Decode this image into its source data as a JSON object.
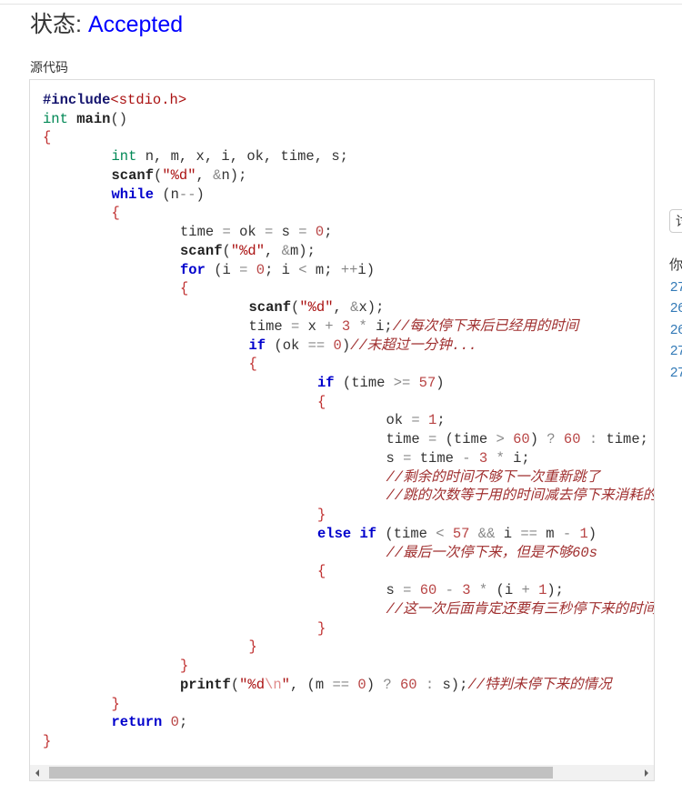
{
  "status": {
    "label": "状态:",
    "value": "Accepted"
  },
  "source_label": "源代码",
  "code": {
    "lines": [
      {
        "indent": 0,
        "tokens": [
          {
            "pp": "#include"
          },
          {
            "hdr": "<stdio.h>"
          }
        ]
      },
      {
        "indent": 0,
        "tokens": [
          {
            "type": "int"
          },
          {
            "x": " "
          },
          {
            "fn": "main"
          },
          {
            "x": "()"
          }
        ]
      },
      {
        "indent": 0,
        "tokens": [
          {
            "br": "{"
          }
        ]
      },
      {
        "indent": 1,
        "tokens": [
          {
            "type": "int"
          },
          {
            "x": " n, m, x, i, ok, time, s;"
          }
        ]
      },
      {
        "indent": 1,
        "tokens": [
          {
            "fn": "scanf"
          },
          {
            "x": "("
          },
          {
            "str": "\"%d\""
          },
          {
            "x": ", "
          },
          {
            "op": "&"
          },
          {
            "x": "n);"
          }
        ]
      },
      {
        "indent": 1,
        "tokens": [
          {
            "kw": "while"
          },
          {
            "x": " (n"
          },
          {
            "op": "--"
          },
          {
            "x": ")"
          }
        ]
      },
      {
        "indent": 1,
        "tokens": [
          {
            "br": "{"
          }
        ]
      },
      {
        "indent": 2,
        "tokens": [
          {
            "x": "time "
          },
          {
            "op": "="
          },
          {
            "x": " ok "
          },
          {
            "op": "="
          },
          {
            "x": " s "
          },
          {
            "op": "="
          },
          {
            "x": " "
          },
          {
            "num": "0"
          },
          {
            "x": ";"
          }
        ]
      },
      {
        "indent": 2,
        "tokens": [
          {
            "fn": "scanf"
          },
          {
            "x": "("
          },
          {
            "str": "\"%d\""
          },
          {
            "x": ", "
          },
          {
            "op": "&"
          },
          {
            "x": "m);"
          }
        ]
      },
      {
        "indent": 2,
        "tokens": [
          {
            "kw": "for"
          },
          {
            "x": " (i "
          },
          {
            "op": "="
          },
          {
            "x": " "
          },
          {
            "num": "0"
          },
          {
            "x": "; i "
          },
          {
            "op": "<"
          },
          {
            "x": " m; "
          },
          {
            "op": "++"
          },
          {
            "x": "i)"
          }
        ]
      },
      {
        "indent": 2,
        "tokens": [
          {
            "br": "{"
          }
        ]
      },
      {
        "indent": 3,
        "tokens": [
          {
            "fn": "scanf"
          },
          {
            "x": "("
          },
          {
            "str": "\"%d\""
          },
          {
            "x": ", "
          },
          {
            "op": "&"
          },
          {
            "x": "x);"
          }
        ]
      },
      {
        "indent": 3,
        "tokens": [
          {
            "x": "time "
          },
          {
            "op": "="
          },
          {
            "x": " x "
          },
          {
            "op": "+"
          },
          {
            "x": " "
          },
          {
            "num": "3"
          },
          {
            "x": " "
          },
          {
            "op": "*"
          },
          {
            "x": " i;"
          },
          {
            "cm": "//每次停下来后已经用的时间"
          }
        ]
      },
      {
        "indent": 3,
        "tokens": [
          {
            "kw": "if"
          },
          {
            "x": " (ok "
          },
          {
            "op": "=="
          },
          {
            "x": " "
          },
          {
            "num": "0"
          },
          {
            "x": ")"
          },
          {
            "cm": "//未超过一分钟..."
          }
        ]
      },
      {
        "indent": 3,
        "tokens": [
          {
            "br": "{"
          }
        ]
      },
      {
        "indent": 4,
        "tokens": [
          {
            "kw": "if"
          },
          {
            "x": " (time "
          },
          {
            "op": ">="
          },
          {
            "x": " "
          },
          {
            "num": "57"
          },
          {
            "x": ")"
          }
        ]
      },
      {
        "indent": 4,
        "tokens": [
          {
            "br": "{"
          }
        ]
      },
      {
        "indent": 5,
        "tokens": [
          {
            "x": "ok "
          },
          {
            "op": "="
          },
          {
            "x": " "
          },
          {
            "num": "1"
          },
          {
            "x": ";"
          }
        ]
      },
      {
        "indent": 5,
        "tokens": [
          {
            "x": "time "
          },
          {
            "op": "="
          },
          {
            "x": " (time "
          },
          {
            "op": ">"
          },
          {
            "x": " "
          },
          {
            "num": "60"
          },
          {
            "x": ") "
          },
          {
            "op": "?"
          },
          {
            "x": " "
          },
          {
            "num": "60"
          },
          {
            "x": " "
          },
          {
            "op": ":"
          },
          {
            "x": " time;"
          }
        ]
      },
      {
        "indent": 5,
        "tokens": [
          {
            "x": "s "
          },
          {
            "op": "="
          },
          {
            "x": " time "
          },
          {
            "op": "-"
          },
          {
            "x": " "
          },
          {
            "num": "3"
          },
          {
            "x": " "
          },
          {
            "op": "*"
          },
          {
            "x": " i;"
          }
        ]
      },
      {
        "indent": 5,
        "tokens": [
          {
            "cm": "//剩余的时间不够下一次重新跳了"
          }
        ]
      },
      {
        "indent": 5,
        "tokens": [
          {
            "cm": "//跳的次数等于用的时间减去停下来消耗的"
          }
        ]
      },
      {
        "indent": 4,
        "tokens": [
          {
            "br": "}"
          }
        ]
      },
      {
        "indent": 4,
        "tokens": [
          {
            "kw": "else if"
          },
          {
            "x": " (time "
          },
          {
            "op": "<"
          },
          {
            "x": " "
          },
          {
            "num": "57"
          },
          {
            "x": " "
          },
          {
            "op": "&&"
          },
          {
            "x": " i "
          },
          {
            "op": "=="
          },
          {
            "x": " m "
          },
          {
            "op": "-"
          },
          {
            "x": " "
          },
          {
            "num": "1"
          },
          {
            "x": ")"
          }
        ]
      },
      {
        "indent": 5,
        "tokens": [
          {
            "cm": "//最后一次停下来，但是不够60s"
          }
        ]
      },
      {
        "indent": 4,
        "tokens": [
          {
            "br": "{"
          }
        ]
      },
      {
        "indent": 5,
        "tokens": [
          {
            "x": "s "
          },
          {
            "op": "="
          },
          {
            "x": " "
          },
          {
            "num": "60"
          },
          {
            "x": " "
          },
          {
            "op": "-"
          },
          {
            "x": " "
          },
          {
            "num": "3"
          },
          {
            "x": " "
          },
          {
            "op": "*"
          },
          {
            "x": " (i "
          },
          {
            "op": "+"
          },
          {
            "x": " "
          },
          {
            "num": "1"
          },
          {
            "x": ");"
          }
        ]
      },
      {
        "indent": 5,
        "tokens": [
          {
            "cm": "//这一次后面肯定还要有三秒停下来的时间"
          }
        ]
      },
      {
        "indent": 4,
        "tokens": [
          {
            "br": "}"
          }
        ]
      },
      {
        "indent": 3,
        "tokens": [
          {
            "br": "}"
          }
        ]
      },
      {
        "indent": 2,
        "tokens": [
          {
            "br": "}"
          }
        ]
      },
      {
        "indent": 2,
        "tokens": [
          {
            "fn": "printf"
          },
          {
            "x": "("
          },
          {
            "str": "\"%d"
          },
          {
            "esc": "\\n"
          },
          {
            "str": "\""
          },
          {
            "x": ", (m "
          },
          {
            "op": "=="
          },
          {
            "x": " "
          },
          {
            "num": "0"
          },
          {
            "x": ") "
          },
          {
            "op": "?"
          },
          {
            "x": " "
          },
          {
            "num": "60"
          },
          {
            "x": " "
          },
          {
            "op": ":"
          },
          {
            "x": " s);"
          },
          {
            "cm": "//特判未停下来的情况"
          }
        ]
      },
      {
        "indent": 1,
        "tokens": [
          {
            "br": "}"
          }
        ]
      },
      {
        "indent": 1,
        "tokens": [
          {
            "kw": "return"
          },
          {
            "x": " "
          },
          {
            "num": "0"
          },
          {
            "x": ";"
          }
        ]
      },
      {
        "indent": 0,
        "tokens": [
          {
            "br": "}"
          }
        ]
      }
    ]
  },
  "scrollbar": {
    "position": 0,
    "visible_fraction": 0.86
  },
  "sidebar": {
    "button_label": "讨",
    "heading": "你",
    "links": [
      "27",
      "26",
      "26",
      "27",
      "27"
    ]
  },
  "colors": {
    "status_accepted": "#0000ff",
    "sidebar_link": "#337ab7"
  }
}
